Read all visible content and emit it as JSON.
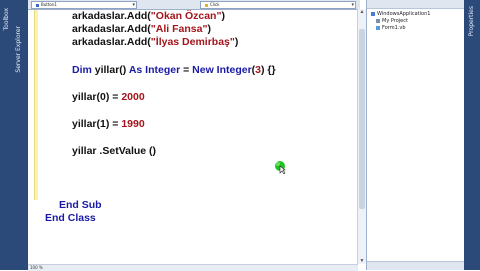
{
  "left_panel": {
    "tabs": [
      "Toolbox",
      "Server Explorer"
    ]
  },
  "right_panel": {
    "tabs": [
      "Properties"
    ]
  },
  "toolbar": {
    "object_combo": "Button1",
    "event_combo": "Click"
  },
  "code": {
    "lines": [
      {
        "parts": [
          {
            "t": "arkadaslar.Add(",
            "c": "plain"
          },
          {
            "t": "\"Okan Özcan\"",
            "c": "str"
          },
          {
            "t": ")",
            "c": "plain"
          }
        ]
      },
      {
        "parts": [
          {
            "t": "arkadaslar.Add(",
            "c": "plain"
          },
          {
            "t": "\"Ali Fansa\"",
            "c": "str"
          },
          {
            "t": ")",
            "c": "plain"
          }
        ]
      },
      {
        "parts": [
          {
            "t": "arkadaslar.Add(",
            "c": "plain"
          },
          {
            "t": "\"İlyas Demirbaş\"",
            "c": "str"
          },
          {
            "t": ")",
            "c": "plain"
          }
        ]
      },
      {
        "parts": [
          {
            "t": "Dim",
            "c": "kw"
          },
          {
            "t": " yillar() ",
            "c": "plain"
          },
          {
            "t": "As Integer",
            "c": "kw"
          },
          {
            "t": " = ",
            "c": "plain"
          },
          {
            "t": "New Integer",
            "c": "kw"
          },
          {
            "t": "(",
            "c": "plain"
          },
          {
            "t": "3",
            "c": "num"
          },
          {
            "t": ") {}",
            "c": "plain"
          }
        ]
      },
      {
        "parts": [
          {
            "t": "yillar(0) = ",
            "c": "plain"
          },
          {
            "t": "2000",
            "c": "num"
          }
        ]
      },
      {
        "parts": [
          {
            "t": "yillar(1) = ",
            "c": "plain"
          },
          {
            "t": "1990",
            "c": "num"
          }
        ]
      },
      {
        "parts": [
          {
            "t": "yillar .SetValue ()",
            "c": "plain"
          }
        ]
      },
      {
        "parts": [
          {
            "t": "End Sub",
            "c": "kw"
          }
        ]
      },
      {
        "parts": [
          {
            "t": "End Class",
            "c": "kw"
          }
        ]
      }
    ]
  },
  "solution_explorer": {
    "items": [
      {
        "label": "WindowsApplication1",
        "icon": "project-icon"
      },
      {
        "label": "My Project",
        "icon": "properties-icon"
      },
      {
        "label": "Form1.vb",
        "icon": "form-icon"
      }
    ]
  },
  "status": {
    "zoom": "100 %"
  },
  "colors": {
    "keyword": "#1a1aa6",
    "string": "#a3151c",
    "chrome": "#2b4a7a"
  }
}
